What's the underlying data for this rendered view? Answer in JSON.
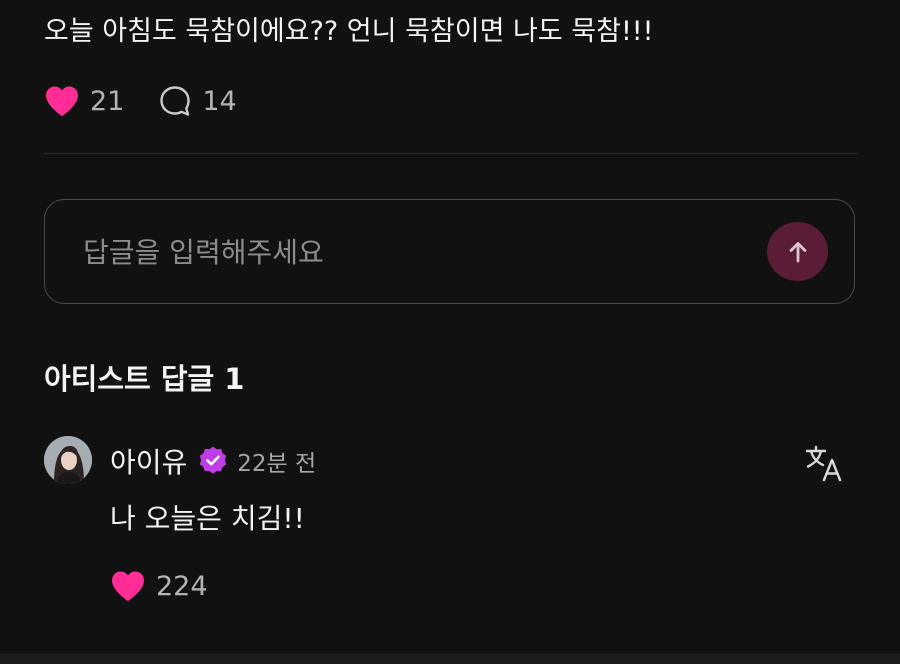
{
  "post": {
    "text": "오늘 아침도 묵참이에요?? 언니 묵참이면 나도 묵참!!!",
    "like_icon": "heart-filled-icon",
    "like_count": "21",
    "comment_icon": "comment-bubble-icon",
    "comment_count": "14"
  },
  "reply": {
    "placeholder": "답글을 입력해주세요",
    "send_icon": "arrow-up-icon"
  },
  "artist_replies": {
    "title": "아티스트 답글 1",
    "items": [
      {
        "author": "아이유",
        "verified_icon": "verified-badge-icon",
        "time": "22분 전",
        "translate_icon": "translate-icon",
        "text": "나 오늘은 치김!!",
        "like_count": "224"
      }
    ]
  },
  "colors": {
    "background": "#121112",
    "heart": "#ff2d95",
    "verified": "#c03ce6",
    "send_button": "#5b1c37",
    "muted_text": "#b4b4b6"
  }
}
